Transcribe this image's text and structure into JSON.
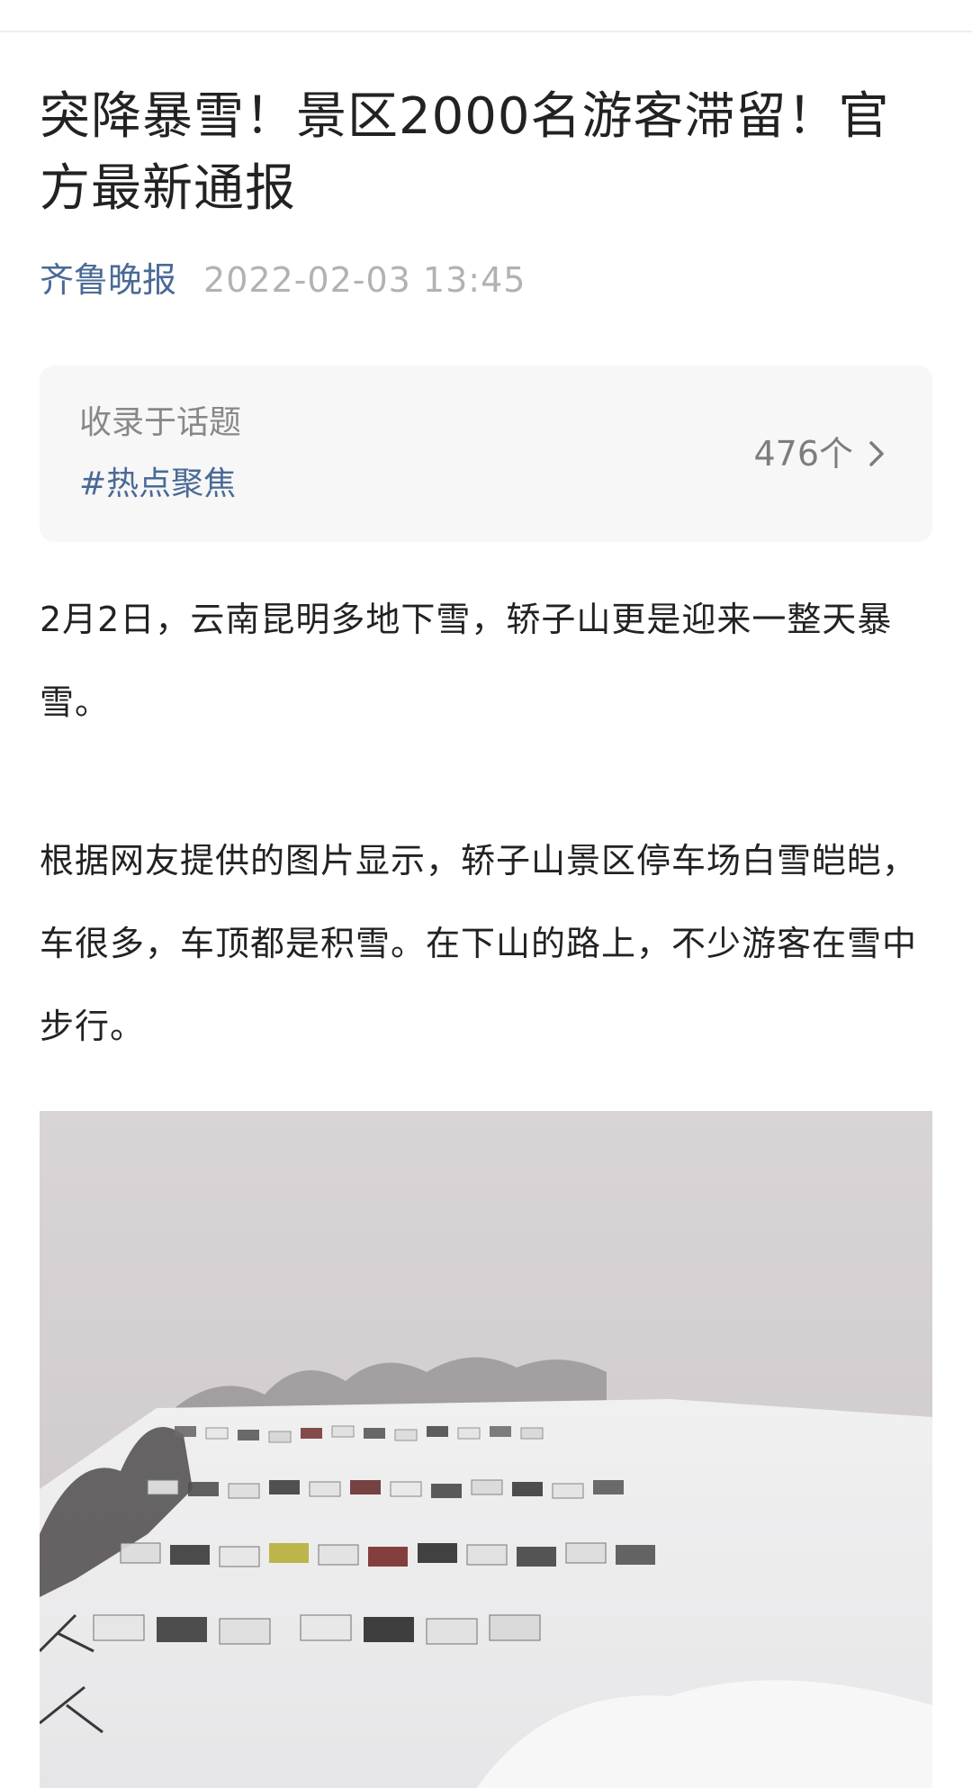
{
  "article": {
    "title": "突降暴雪！景区2000名游客滞留！官方最新通报",
    "source": "齐鲁晚报",
    "date": "2022-02-03 13:45"
  },
  "topic": {
    "label": "收录于话题",
    "tag": "#热点聚焦",
    "count": "476个"
  },
  "body": {
    "paragraph_1": "2月2日，云南昆明多地下雪，轿子山更是迎来一整天暴雪。",
    "paragraph_2": "根据网友提供的图片显示，轿子山景区停车场白雪皑皑，车很多，车顶都是积雪。在下山的路上，不少游客在雪中步行。"
  },
  "icons": {
    "chevron": "chevron-right-icon"
  },
  "colors": {
    "title": "#222222",
    "source": "#4a6a96",
    "date": "#b2b2b2",
    "card_bg": "#f7f7f7",
    "tag": "#4a6a96"
  }
}
